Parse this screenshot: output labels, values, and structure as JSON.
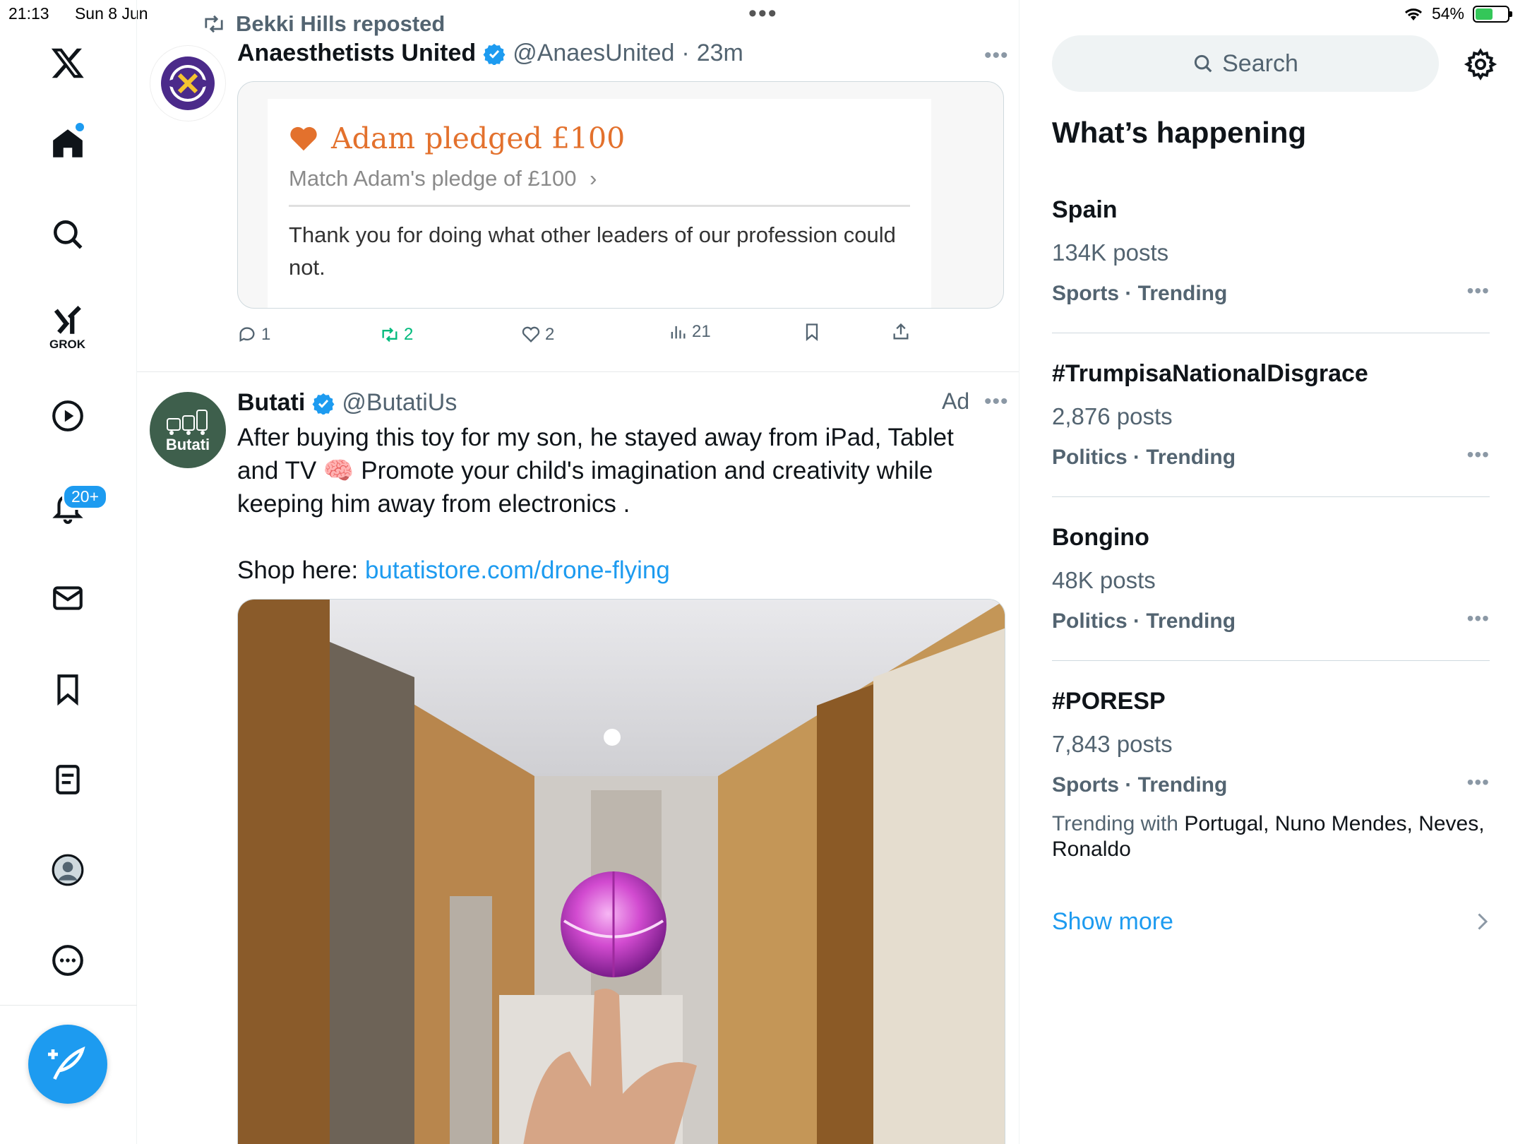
{
  "status_bar": {
    "time": "21:13",
    "date": "Sun 8 Jun",
    "battery_text": "54%",
    "battery_level": 0.54,
    "battery_color": "#34c759"
  },
  "nav": {
    "items": [
      {
        "name": "x-logo",
        "icon": "x-logo-icon"
      },
      {
        "name": "home",
        "icon": "home-icon"
      },
      {
        "name": "explore",
        "icon": "search-icon"
      },
      {
        "name": "grok",
        "icon": "grok-icon",
        "label": "GROK"
      },
      {
        "name": "video",
        "icon": "play-icon"
      },
      {
        "name": "notifications",
        "icon": "bell-icon",
        "badge": "20+"
      },
      {
        "name": "messages",
        "icon": "mail-icon"
      },
      {
        "name": "bookmarks",
        "icon": "bookmark-icon"
      },
      {
        "name": "lists",
        "icon": "list-icon"
      },
      {
        "name": "profile",
        "icon": "avatar-icon"
      },
      {
        "name": "more",
        "icon": "more-circle-icon"
      }
    ],
    "compose_icon": "compose-icon"
  },
  "feed": {
    "post1": {
      "repost_by": "Bekki Hills reposted",
      "author": "Anaesthetists United",
      "handle": "@AnaesUnited",
      "separator": "·",
      "time": "23m",
      "card": {
        "title": "Adam pledged £100",
        "subtitle": "Match Adam's pledge of £100",
        "text": "Thank you for doing what other leaders of our profession could not."
      },
      "stats": {
        "replies": "1",
        "reposts": "2",
        "likes": "2",
        "views": "21"
      }
    },
    "post2": {
      "author": "Butati",
      "handle": "@ButatiUs",
      "ad_label": "Ad",
      "avatar_text": "Butati",
      "text": "After buying this toy for my son, he stayed away from iPad, Tablet and TV 🧠 Promote your child's imagination and creativity while keeping him away from electronics .",
      "shop_prefix": "Shop here: ",
      "link": "butatistore.com/drone-flying"
    }
  },
  "sidebar": {
    "search_placeholder": "Search",
    "section_title": "What’s happening",
    "trends": [
      {
        "title": "Spain",
        "posts": "134K posts",
        "category": "Sports · Trending"
      },
      {
        "title": "#TrumpisaNationalDisgrace",
        "posts": "2,876 posts",
        "category": "Politics · Trending"
      },
      {
        "title": "Bongino",
        "posts": "48K posts",
        "category": "Politics · Trending"
      },
      {
        "title": "#PORESP",
        "posts": "7,843 posts",
        "category": "Sports · Trending",
        "with_prefix": "Trending with",
        "with_names": "Portugal, Nuno Mendes, Neves, Ronaldo"
      }
    ],
    "show_more": "Show more"
  },
  "colors": {
    "accent": "#1d9bf0",
    "repost_green": "#00ba7c",
    "pledge_orange": "#e3712d"
  }
}
